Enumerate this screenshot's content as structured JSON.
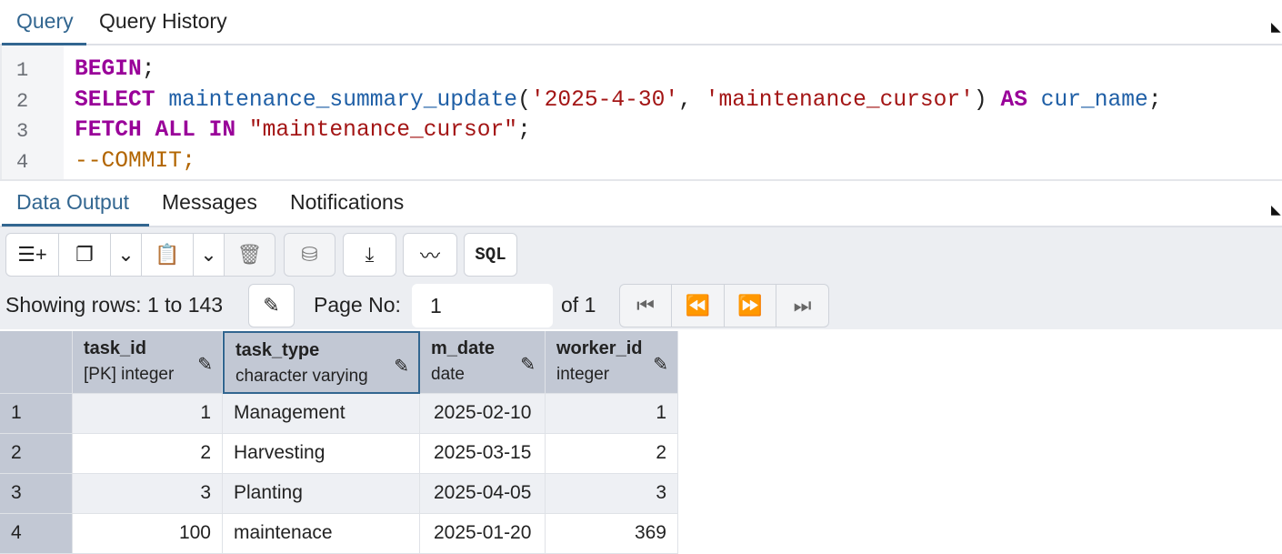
{
  "query_tabs": [
    {
      "label": "Query"
    },
    {
      "label": "Query History"
    }
  ],
  "editor": {
    "lines": [
      {
        "num": "1",
        "tokens": [
          {
            "t": "kw",
            "v": "BEGIN"
          },
          {
            "t": "p",
            "v": ";"
          }
        ]
      },
      {
        "num": "2",
        "tokens": [
          {
            "t": "kw",
            "v": "SELECT"
          },
          {
            "t": "p",
            "v": " "
          },
          {
            "t": "fn",
            "v": "maintenance_summary_update"
          },
          {
            "t": "p",
            "v": "("
          },
          {
            "t": "str",
            "v": "'2025-4-30'"
          },
          {
            "t": "p",
            "v": ", "
          },
          {
            "t": "str",
            "v": "'maintenance_cursor'"
          },
          {
            "t": "p",
            "v": ") "
          },
          {
            "t": "kw",
            "v": "AS"
          },
          {
            "t": "p",
            "v": " "
          },
          {
            "t": "fn",
            "v": "cur_name"
          },
          {
            "t": "p",
            "v": ";"
          }
        ]
      },
      {
        "num": "3",
        "tokens": [
          {
            "t": "kw",
            "v": "FETCH ALL IN"
          },
          {
            "t": "p",
            "v": " "
          },
          {
            "t": "str",
            "v": "\"maintenance_cursor\""
          },
          {
            "t": "p",
            "v": ";"
          }
        ]
      },
      {
        "num": "4",
        "tokens": [
          {
            "t": "cm",
            "v": "--COMMIT;"
          }
        ]
      }
    ]
  },
  "output_tabs": [
    {
      "label": "Data Output"
    },
    {
      "label": "Messages"
    },
    {
      "label": "Notifications"
    }
  ],
  "toolbar": {
    "sql_label": "SQL"
  },
  "pagination": {
    "showing": "Showing rows: 1 to 143",
    "page_label": "Page No:",
    "page_value": "1",
    "of": "of 1"
  },
  "grid": {
    "columns": [
      {
        "name": "task_id",
        "type": "[PK] integer"
      },
      {
        "name": "task_type",
        "type": "character varying"
      },
      {
        "name": "m_date",
        "type": "date"
      },
      {
        "name": "worker_id",
        "type": "integer"
      }
    ],
    "rows": [
      {
        "n": "1",
        "c": [
          "1",
          "Management",
          "2025-02-10",
          "1"
        ]
      },
      {
        "n": "2",
        "c": [
          "2",
          "Harvesting",
          "2025-03-15",
          "2"
        ]
      },
      {
        "n": "3",
        "c": [
          "3",
          "Planting",
          "2025-04-05",
          "3"
        ]
      },
      {
        "n": "4",
        "c": [
          "100",
          "maintenace",
          "2025-01-20",
          "369"
        ]
      }
    ]
  }
}
